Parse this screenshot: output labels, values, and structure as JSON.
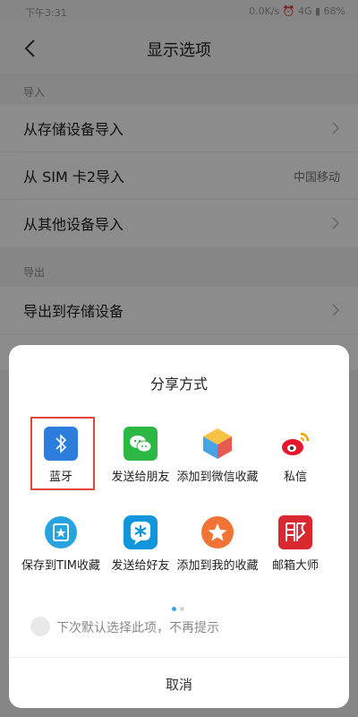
{
  "status_bar": {
    "time": "下午3:31",
    "right": "0.0K/s ⏰ 4G ▮ 68%"
  },
  "header": {
    "title": "显示选项"
  },
  "sections": [
    {
      "header": "导入",
      "rows": [
        {
          "label": "从存储设备导入",
          "value": ""
        },
        {
          "label": "从 SIM 卡2导入",
          "value": "中国移动"
        },
        {
          "label": "从其他设备导入",
          "value": ""
        }
      ]
    },
    {
      "header": "导出",
      "rows": [
        {
          "label": "导出到存储设备",
          "value": ""
        }
      ]
    }
  ],
  "share": {
    "title": "分享方式",
    "items": [
      {
        "label": "蓝牙",
        "icon": "bluetooth-icon"
      },
      {
        "label": "发送给朋友",
        "icon": "wechat-icon"
      },
      {
        "label": "添加到微信收藏",
        "icon": "wechat-favorite-icon"
      },
      {
        "label": "私信",
        "icon": "weibo-icon"
      },
      {
        "label": "保存到TIM收藏",
        "icon": "tim-icon"
      },
      {
        "label": "发送给好友",
        "icon": "qq-icon"
      },
      {
        "label": "添加到我的收藏",
        "icon": "favorites-icon"
      },
      {
        "label": "邮箱大师",
        "icon": "mail-master-icon"
      }
    ],
    "checkbox_label": "下次默认选择此项，不再提示",
    "cancel_label": "取消",
    "accent_color": "#e1453d"
  }
}
